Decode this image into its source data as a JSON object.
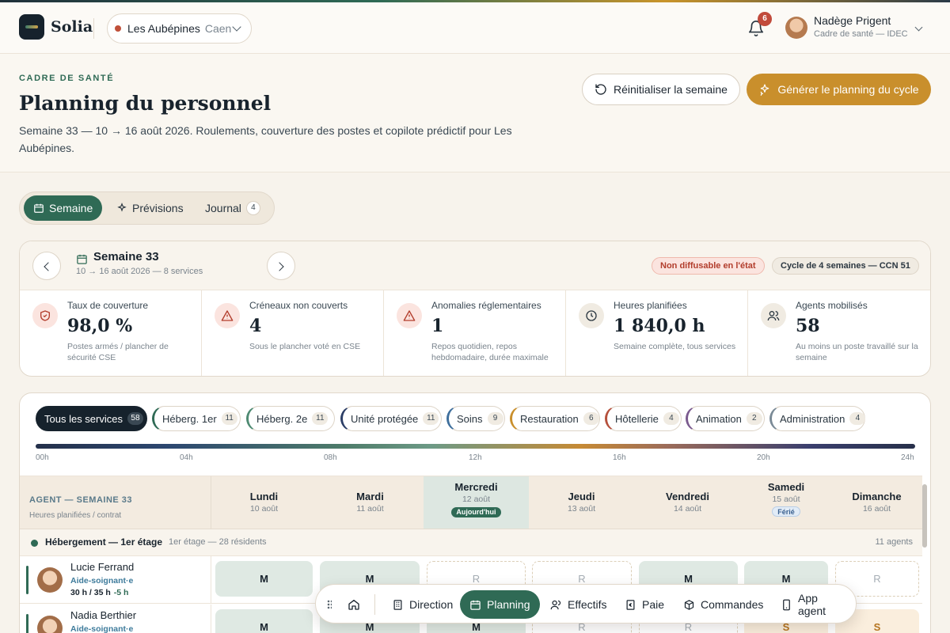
{
  "app": {
    "brand": "Solia"
  },
  "site": {
    "name": "Les Aubépines",
    "city": "Caen"
  },
  "notifications": {
    "count": "6"
  },
  "user": {
    "name": "Nadège Prigent",
    "role": "Cadre de santé — IDEC"
  },
  "hero": {
    "eyebrow": "CADRE DE SANTÉ",
    "title": "Planning du personnel",
    "subtitle": "Semaine 33 — 10 → 16 août 2026. Roulements, couverture des postes et copilote prédictif pour Les Aubépines.",
    "reset_label": "Réinitialiser la semaine",
    "generate_label": "Générer le planning du cycle"
  },
  "tabs": [
    {
      "label": "Semaine"
    },
    {
      "label": "Prévisions"
    },
    {
      "label": "Journal",
      "count": "4"
    }
  ],
  "week": {
    "title": "Semaine 33",
    "subtitle": "10 → 16 août 2026 — 8 services",
    "status": "Non diffusable en l'état",
    "cycle": "Cycle de 4 semaines — CCN 51"
  },
  "kpis": [
    {
      "label": "Taux de couverture",
      "value": "98,0 %",
      "desc": "Postes armés / plancher de sécurité CSE",
      "icon": "shield-icon"
    },
    {
      "label": "Créneaux non couverts",
      "value": "4",
      "desc": "Sous le plancher voté en CSE",
      "icon": "warning-icon"
    },
    {
      "label": "Anomalies réglementaires",
      "value": "1",
      "desc": "Repos quotidien, repos hebdomadaire, durée maximale",
      "icon": "warning-icon"
    },
    {
      "label": "Heures planifiées",
      "value": "1 840,0 h",
      "desc": "Semaine complète, tous services",
      "icon": "clock-icon"
    },
    {
      "label": "Agents mobilisés",
      "value": "58",
      "desc": "Au moins un poste travaillé sur la semaine",
      "icon": "users-icon"
    }
  ],
  "services": [
    {
      "label": "Tous les services",
      "count": "58",
      "color": "#16222c"
    },
    {
      "label": "Héberg. 1er",
      "count": "11",
      "color": "#2f6a55"
    },
    {
      "label": "Héberg. 2e",
      "count": "11",
      "color": "#4e8a72"
    },
    {
      "label": "Unité protégée",
      "count": "11",
      "color": "#2c3e66"
    },
    {
      "label": "Soins",
      "count": "9",
      "color": "#3f6f9c"
    },
    {
      "label": "Restauration",
      "count": "6",
      "color": "#c98f2c"
    },
    {
      "label": "Hôtellerie",
      "count": "4",
      "color": "#b5503c"
    },
    {
      "label": "Animation",
      "count": "2",
      "color": "#7a5a8e"
    },
    {
      "label": "Administration",
      "count": "4",
      "color": "#7a8a96"
    }
  ],
  "timeline": {
    "labels": [
      "00h",
      "04h",
      "08h",
      "12h",
      "16h",
      "20h",
      "24h"
    ]
  },
  "grid": {
    "agent_header": "AGENT — SEMAINE 33",
    "agent_subheader": "Heures planifiées / contrat",
    "days": [
      {
        "name": "Lundi",
        "date": "10 août"
      },
      {
        "name": "Mardi",
        "date": "11 août"
      },
      {
        "name": "Mercredi",
        "date": "12 août",
        "tag": "Aujourd'hui"
      },
      {
        "name": "Jeudi",
        "date": "13 août"
      },
      {
        "name": "Vendredi",
        "date": "14 août"
      },
      {
        "name": "Samedi",
        "date": "15 août",
        "tag": "Férié"
      },
      {
        "name": "Dimanche",
        "date": "16 août"
      }
    ],
    "group": {
      "name": "Hébergement — 1er étage",
      "meta": "1er étage — 28 résidents",
      "count": "11 agents"
    },
    "agents": [
      {
        "name": "Lucie Ferrand",
        "role": "Aide-soignant·e",
        "hours": "30 h / 35 h",
        "delta": "-5 h",
        "shifts": [
          "M",
          "M",
          "R",
          "R",
          "M",
          "M",
          "R"
        ]
      },
      {
        "name": "Nadia Berthier",
        "role": "Aide-soignant·e",
        "hours": "",
        "delta": "",
        "shifts": [
          "M",
          "M",
          "M",
          "R",
          "R",
          "S",
          "S"
        ]
      }
    ]
  },
  "dock": {
    "items": [
      {
        "label": "Direction"
      },
      {
        "label": "Planning"
      },
      {
        "label": "Effectifs"
      },
      {
        "label": "Paie"
      },
      {
        "label": "Commandes"
      },
      {
        "label": "App agent"
      }
    ]
  }
}
